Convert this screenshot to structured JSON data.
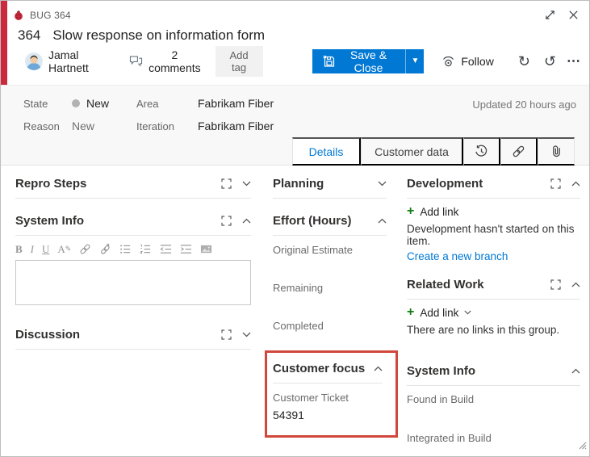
{
  "colors": {
    "accent_blue": "#0078d4",
    "bug_red": "#cc293d",
    "annotation_red": "#d1473c",
    "state_dot_gray": "#b2b2b2",
    "add_link_green": "#107c10",
    "meta_background": "#f8f8f8"
  },
  "header": {
    "work_item_type": "BUG 364",
    "id": "364",
    "title": "Slow response on information form",
    "assignee": "Jamal Hartnett",
    "comments_label": "2 comments",
    "add_tag_label": "Add tag",
    "save_close_label": "Save & Close",
    "follow_label": "Follow"
  },
  "meta": {
    "state_label": "State",
    "state_value": "New",
    "reason_label": "Reason",
    "reason_value": "New",
    "area_label": "Area",
    "area_value": "Fabrikam Fiber",
    "iteration_label": "Iteration",
    "iteration_value": "Fabrikam Fiber",
    "updated_text": "Updated 20 hours ago"
  },
  "tabs": {
    "details": "Details",
    "customer_data": "Customer data"
  },
  "left": {
    "repro_steps_title": "Repro Steps",
    "system_info_title": "System Info",
    "discussion_title": "Discussion",
    "editor_value": "",
    "toolbar": {
      "bold": "B",
      "italic": "I",
      "underline": "U",
      "format": "A"
    }
  },
  "middle": {
    "planning_title": "Planning",
    "effort_title": "Effort (Hours)",
    "original_estimate_label": "Original Estimate",
    "remaining_label": "Remaining",
    "completed_label": "Completed",
    "customer_focus_title": "Customer focus",
    "customer_ticket_label": "Customer Ticket",
    "customer_ticket_value": "54391"
  },
  "right": {
    "development_title": "Development",
    "dev_add_link_label": "Add link",
    "dev_empty_text": "Development hasn't started on this item.",
    "create_branch_label": "Create a new branch",
    "related_work_title": "Related Work",
    "related_add_link_label": "Add link",
    "related_empty_text": "There are no links in this group.",
    "system_info_title": "System Info",
    "found_in_build_label": "Found in Build",
    "integrated_in_build_label": "Integrated in Build"
  },
  "icons": {
    "more_glyph": "⋯",
    "refresh_glyph": "↻",
    "undo_glyph": "↺",
    "caret_glyph": "▼",
    "pen_glyph": "✎"
  }
}
